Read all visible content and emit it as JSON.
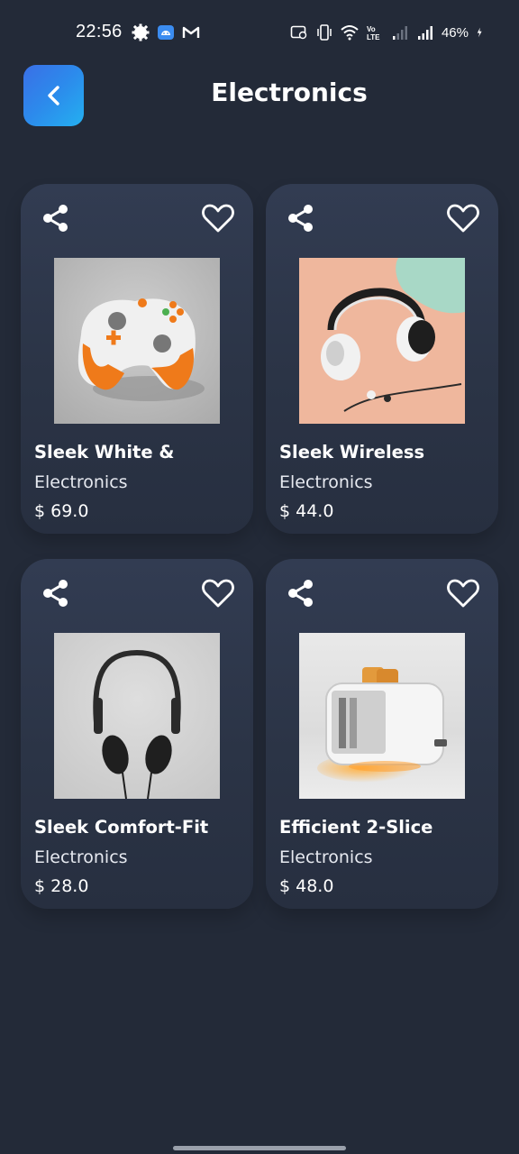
{
  "status_bar": {
    "time": "22:56",
    "battery": "46%",
    "icons": [
      "settings-gear-icon",
      "android-icon",
      "gmail-icon",
      "screen-record-icon",
      "vibrate-icon",
      "wifi-icon",
      "volte-icon",
      "signal-icon",
      "battery-charging-icon"
    ]
  },
  "header": {
    "back_icon": "chevron-left-icon",
    "title": "Electronics",
    "accent_gradient": [
      "#3a6fe6",
      "#24b0f0"
    ]
  },
  "products": [
    {
      "name": "Sleek White &",
      "category": "Electronics",
      "price": "$ 69.0",
      "image": "game-controller-image"
    },
    {
      "name": "Sleek Wireless",
      "category": "Electronics",
      "price": "$ 44.0",
      "image": "headphones-image"
    },
    {
      "name": "Sleek Comfort-Fit",
      "category": "Electronics",
      "price": "$ 28.0",
      "image": "on-ear-headphones-image"
    },
    {
      "name": "Efficient 2-Slice",
      "category": "Electronics",
      "price": "$ 48.0",
      "image": "toaster-image"
    }
  ],
  "colors": {
    "background": "#232a38",
    "card": "#2e374b",
    "text": "#ffffff"
  }
}
